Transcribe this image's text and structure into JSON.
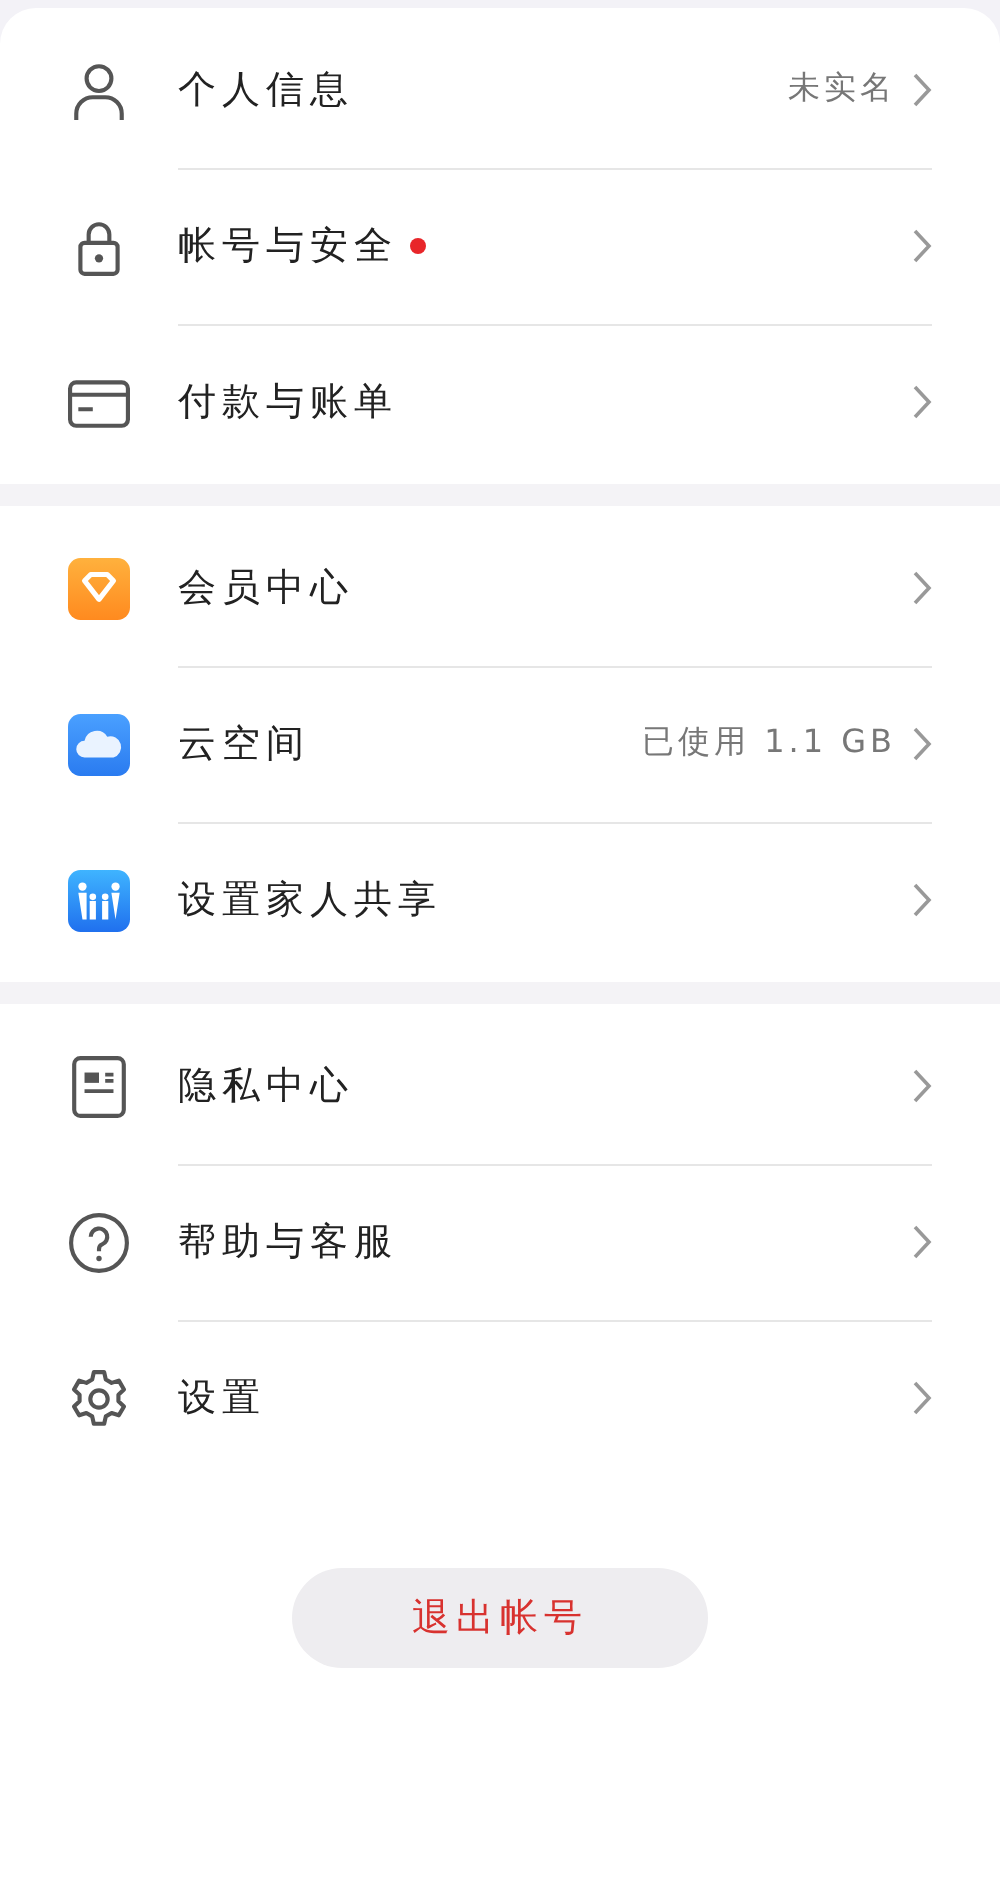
{
  "sections": [
    {
      "items": [
        {
          "label": "个人信息",
          "detail": "未实名",
          "dot": false
        },
        {
          "label": "帐号与安全",
          "dot": true
        },
        {
          "label": "付款与账单",
          "dot": false
        }
      ]
    },
    {
      "items": [
        {
          "label": "会员中心",
          "dot": false
        },
        {
          "label": "云空间",
          "detail": "已使用 1.1 GB",
          "dot": false
        },
        {
          "label": "设置家人共享",
          "dot": false
        }
      ]
    },
    {
      "items": [
        {
          "label": "隐私中心",
          "dot": false
        },
        {
          "label": "帮助与客服",
          "dot": false
        },
        {
          "label": "设置",
          "dot": false
        }
      ]
    }
  ],
  "logout_button": "退出帐号"
}
